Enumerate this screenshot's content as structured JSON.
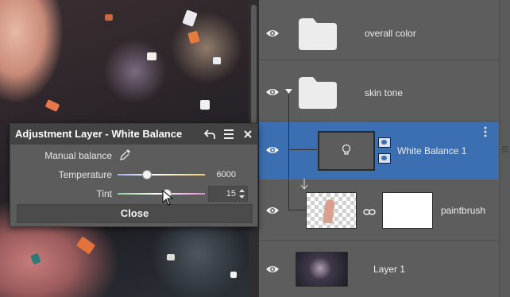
{
  "dialog": {
    "title": "Adjustment Layer - White Balance",
    "manual_balance_label": "Manual balance",
    "temperature": {
      "label": "Temperature",
      "value": "6000",
      "fraction": 0.33
    },
    "tint": {
      "label": "Tint",
      "value": "15",
      "fraction": 0.55
    },
    "close_label": "Close",
    "icons": [
      "undo-icon",
      "menu-icon",
      "close-icon",
      "eyedropper-icon"
    ]
  },
  "layers": {
    "items": [
      {
        "name": "overall color",
        "type": "folder",
        "visible": true
      },
      {
        "name": "skin tone",
        "type": "folder",
        "visible": true,
        "expanded": true
      },
      {
        "name": "White Balance 1",
        "type": "adjustment",
        "visible": true,
        "selected": true
      },
      {
        "name": "paintbrush",
        "type": "masked-layer",
        "visible": true
      },
      {
        "name": "Layer 1",
        "type": "image",
        "visible": true
      }
    ]
  },
  "colors": {
    "panel_bg": "#5d5d5d",
    "selection": "#3b6fb1",
    "dialog_bg": "#5c5c5c",
    "dialog_title_bg": "#434343"
  }
}
